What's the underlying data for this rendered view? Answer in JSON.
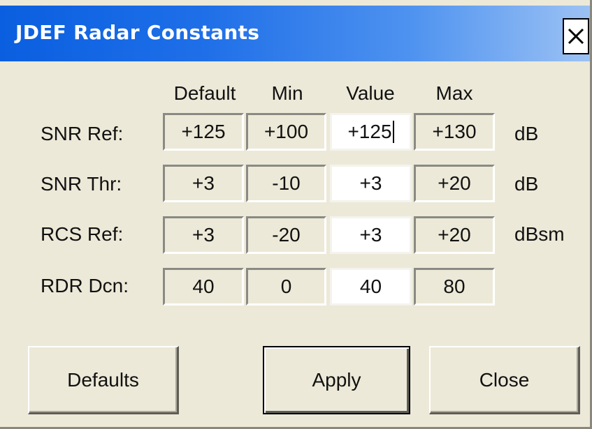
{
  "window": {
    "title": "JDEF Radar Constants",
    "close_glyph": "✕",
    "close_icon": "close-icon"
  },
  "columns": {
    "default": "Default",
    "min": "Min",
    "value": "Value",
    "max": "Max"
  },
  "rows": [
    {
      "label": "SNR Ref:",
      "default": "+125",
      "min": "+100",
      "value": "+125",
      "max": "+130",
      "unit": "dB"
    },
    {
      "label": "SNR Thr:",
      "default": "+3",
      "min": "-10",
      "value": "+3",
      "max": "+20",
      "unit": "dB"
    },
    {
      "label": "RCS Ref:",
      "default": "+3",
      "min": "-20",
      "value": "+3",
      "max": "+20",
      "unit": "dBsm"
    },
    {
      "label": "RDR Dcn:",
      "default": "40",
      "min": "0",
      "value": "40",
      "max": "80",
      "unit": ""
    }
  ],
  "buttons": {
    "defaults": "Defaults",
    "apply": "Apply",
    "close": "Close"
  },
  "colors": {
    "titlebar_start": "#0a5fe0",
    "titlebar_end": "#9cc2f4",
    "dialog_background": "#ece9d8"
  }
}
